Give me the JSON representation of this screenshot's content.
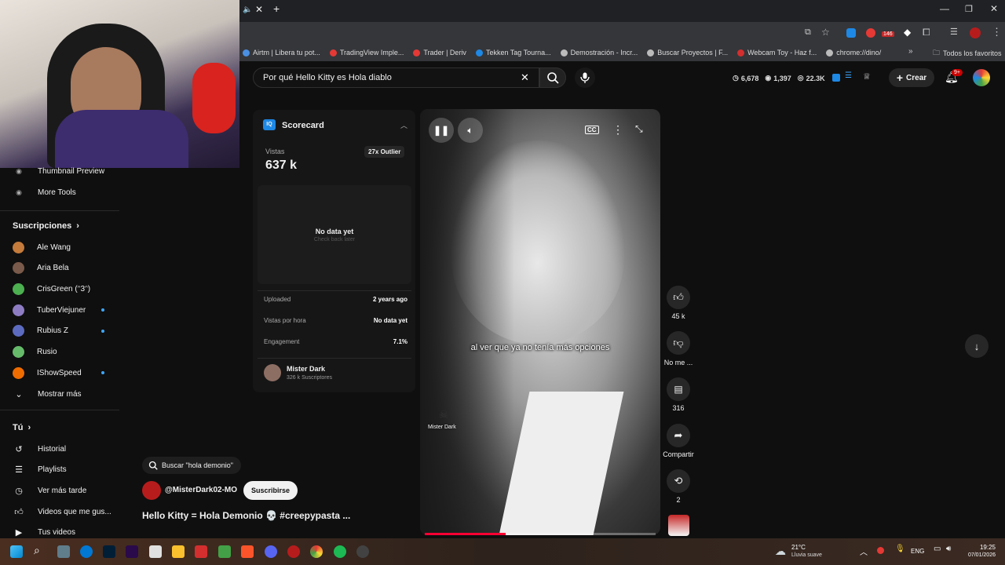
{
  "browser": {
    "bookmarks": [
      {
        "label": "Airtm | Libera tu pot...",
        "color": "#4a90e2"
      },
      {
        "label": "TradingView Imple...",
        "color": "#e53935"
      },
      {
        "label": "Trader | Deriv",
        "color": "#e53935"
      },
      {
        "label": "Tekken Tag Tourna...",
        "color": "#1e88e5"
      },
      {
        "label": "Demostración - Incr...",
        "color": "#bbbbbb"
      },
      {
        "label": "Buscar Proyectos | F...",
        "color": "#bbbbbb"
      },
      {
        "label": "Webcam Toy - Haz f...",
        "color": "#d32f2f"
      },
      {
        "label": "chrome://dino/",
        "color": "#bbbbbb"
      }
    ],
    "all_bookmarks": "Todos los favoritos",
    "ext_badge": "146"
  },
  "header": {
    "search_value": "Por qué Hello Kitty es Hola diablo",
    "stats": {
      "a": "6,678",
      "b": "1,397",
      "c": "22.3K"
    },
    "create_label": "Crear",
    "notif_badge": "9+"
  },
  "sidebar": {
    "top_items": [
      "Thumbnail Preview",
      "More Tools"
    ],
    "subs_title": "Suscripciones",
    "subs": [
      {
        "name": "Ale Wang",
        "color": "#c47b3b",
        "dot": false
      },
      {
        "name": "Aria Bela",
        "color": "#7a5a4a",
        "dot": false
      },
      {
        "name": "CrisGreen (ᵔ3ᵔ)",
        "color": "#4caf50",
        "dot": false
      },
      {
        "name": "TuberViejuner",
        "color": "#8e7cc3",
        "dot": true
      },
      {
        "name": "Rubius Z",
        "color": "#5c6bc0",
        "dot": true
      },
      {
        "name": "Rusio",
        "color": "#66bb6a",
        "dot": false
      },
      {
        "name": "IShowSpeed",
        "color": "#ef6c00",
        "dot": true
      }
    ],
    "show_more": "Mostrar más",
    "you_title": "Tú",
    "you_items": [
      "Historial",
      "Playlists",
      "Ver más tarde",
      "Videos que me gus...",
      "Tus videos"
    ]
  },
  "scorecard": {
    "title": "Scorecard",
    "views_label": "Vistas",
    "views_value": "637 k",
    "outlier": "27x Outlier",
    "no_data": "No data yet",
    "check_back": "Check back later",
    "rows": [
      {
        "label": "Uploaded",
        "value": "2 years ago"
      },
      {
        "label": "Vistas por hora",
        "value": "No data yet"
      },
      {
        "label": "Engagement",
        "value": "7.1%"
      }
    ],
    "channel_name": "Mister Dark",
    "channel_subs": "326 k Suscriptores"
  },
  "video": {
    "caption": "al ver que ya no tenía más opciones",
    "watermark": "Mister Dark",
    "search_chip": "Buscar \"hola demonio\"",
    "channel": "@MisterDark02-MO",
    "subscribe": "Suscribirse",
    "title": "Hello Kitty = Hola Demonio 💀 #creepypasta ...",
    "progress": 0.35
  },
  "actions": {
    "likes": "45 k",
    "dislike": "No me ...",
    "comments": "316",
    "share": "Compartir",
    "remix": "2"
  },
  "taskbar": {
    "weather_temp": "21°C",
    "weather_desc": "Lluvia suave",
    "lang": "ENG",
    "time": "19:25",
    "date": "07/01/2026"
  }
}
